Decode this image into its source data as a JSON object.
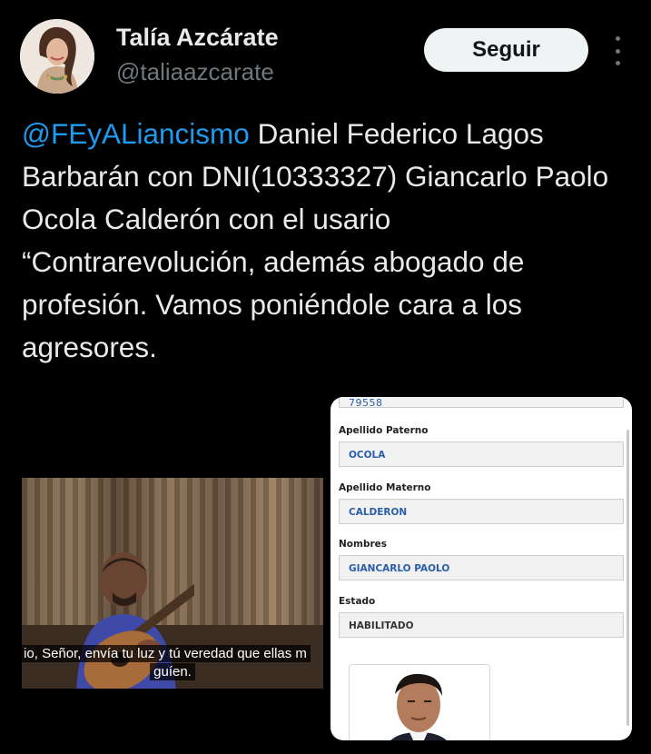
{
  "author": {
    "name": "Talía Azcárate",
    "handle": "@taliaazcarate",
    "avatar_icon": "profile-photo"
  },
  "actions": {
    "follow_label": "Seguir",
    "more_icon": "more-vertical-icon"
  },
  "tweet": {
    "mention": "@FEyALiancismo",
    "text": " Daniel Federico Lagos Barbarán con DNI(10333327) Giancarlo Paolo Ocola Calderón con el usario “Contrarevolución, además abogado de profesión. Vamos poniéndole cara a los agresores."
  },
  "video": {
    "caption_line1": "io, Señor, envía tu luz y tú veredad que ellas m",
    "caption_line2": "guíen."
  },
  "document": {
    "top_value": "79558",
    "fields": [
      {
        "label": "Apellido Paterno",
        "value": "OCOLA"
      },
      {
        "label": "Apellido Materno",
        "value": "CALDERON"
      },
      {
        "label": "Nombres",
        "value": "GIANCARLO PAOLO"
      },
      {
        "label": "Estado",
        "value": "HABILITADO"
      }
    ]
  },
  "colors": {
    "background": "#000000",
    "text": "#e7e9ea",
    "secondary": "#71767b",
    "link": "#1d9bf0",
    "doc_value": "#2a5ea8"
  }
}
